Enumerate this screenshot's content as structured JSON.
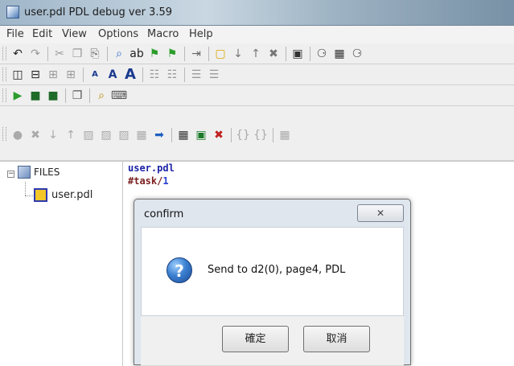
{
  "window": {
    "title": "user.pdl  PDL debug ver 3.59"
  },
  "menu": [
    "File",
    "Edit",
    "View",
    "Options",
    "Macro",
    "Help"
  ],
  "toolbar1": [
    {
      "icon": "undo-icon",
      "glyph": "↶",
      "color": "#222"
    },
    {
      "icon": "redo-icon",
      "glyph": "↷",
      "color": "#999"
    },
    {
      "sep": true
    },
    {
      "icon": "cut-icon",
      "glyph": "✂",
      "color": "#999"
    },
    {
      "icon": "copy-icon",
      "glyph": "❐",
      "color": "#999"
    },
    {
      "icon": "paste-icon",
      "glyph": "⎘",
      "color": "#666"
    },
    {
      "sep": true
    },
    {
      "icon": "find-icon",
      "glyph": "⌕",
      "color": "#2a6cc7"
    },
    {
      "icon": "replace-icon",
      "glyph": "ab",
      "color": "#222"
    },
    {
      "icon": "find-next-icon",
      "glyph": "⚑",
      "color": "#2a9d2a"
    },
    {
      "icon": "find-prev-icon",
      "glyph": "⚑",
      "color": "#2a9d2a"
    },
    {
      "sep": true
    },
    {
      "icon": "indent-icon",
      "glyph": "⇥",
      "color": "#666"
    },
    {
      "sep": true
    },
    {
      "icon": "bookmark-icon",
      "glyph": "▢",
      "color": "#d8a800"
    },
    {
      "icon": "next-bookmark-icon",
      "glyph": "↓",
      "color": "#777"
    },
    {
      "icon": "prev-bookmark-icon",
      "glyph": "↑",
      "color": "#777"
    },
    {
      "icon": "clear-bookmarks-icon",
      "glyph": "✖",
      "color": "#777"
    },
    {
      "sep": true
    },
    {
      "icon": "save-all-icon",
      "glyph": "▣",
      "color": "#333"
    },
    {
      "sep": true
    },
    {
      "icon": "binoculars-icon",
      "glyph": "⚆",
      "color": "#333"
    },
    {
      "icon": "find-in-files-icon",
      "glyph": "▦",
      "color": "#333"
    },
    {
      "icon": "search-binoculars-icon",
      "glyph": "⚆",
      "color": "#333"
    }
  ],
  "toolbar2": [
    {
      "icon": "split-vertical-icon",
      "glyph": "◫",
      "color": "#222"
    },
    {
      "icon": "split-horizontal-icon",
      "glyph": "⊟",
      "color": "#222"
    },
    {
      "icon": "tile-icon",
      "glyph": "⊞",
      "color": "#999"
    },
    {
      "icon": "tile-grid-icon",
      "glyph": "⊞",
      "color": "#999"
    },
    {
      "sep": true
    },
    {
      "icon": "font-small-icon",
      "glyph": "A",
      "color": "#1b3a8f",
      "size": "10px"
    },
    {
      "icon": "font-medium-icon",
      "glyph": "A",
      "color": "#1b3a8f",
      "size": "14px"
    },
    {
      "icon": "font-large-icon",
      "glyph": "A",
      "color": "#1b3a8f",
      "size": "18px"
    },
    {
      "sep": true
    },
    {
      "icon": "format-icon",
      "glyph": "☷",
      "color": "#999"
    },
    {
      "icon": "format-block-icon",
      "glyph": "☷",
      "color": "#999"
    },
    {
      "sep": true
    },
    {
      "icon": "align-icon",
      "glyph": "☰",
      "color": "#999"
    },
    {
      "icon": "align-outdent-icon",
      "glyph": "☰",
      "color": "#999"
    }
  ],
  "toolbar3": [
    {
      "icon": "open-folder-icon",
      "glyph": "▶",
      "color": "#2d9b2d"
    },
    {
      "icon": "save-icon",
      "glyph": "■",
      "color": "#1f6b2a"
    },
    {
      "icon": "save-as-icon",
      "glyph": "■",
      "color": "#1f6b2a"
    },
    {
      "sep": true
    },
    {
      "icon": "pages-icon",
      "glyph": "❐",
      "color": "#555"
    },
    {
      "sep": true
    },
    {
      "icon": "zoom-icon",
      "glyph": "⌕",
      "color": "#b38600"
    },
    {
      "icon": "keyboard-icon",
      "glyph": "⌨",
      "color": "#555"
    }
  ],
  "toolbar4": [
    {
      "icon": "breakpoint-icon",
      "glyph": "●",
      "color": "#aaa"
    },
    {
      "icon": "clear-breakpoint-icon",
      "glyph": "✖",
      "color": "#aaa"
    },
    {
      "icon": "step-into-icon",
      "glyph": "↓",
      "color": "#aaa"
    },
    {
      "icon": "step-out-icon",
      "glyph": "↑",
      "color": "#aaa"
    },
    {
      "icon": "run-icon",
      "glyph": "▨",
      "color": "#aaa"
    },
    {
      "icon": "run-to-cursor-icon",
      "glyph": "▨",
      "color": "#aaa"
    },
    {
      "icon": "compile-icon",
      "glyph": "▨",
      "color": "#aaa"
    },
    {
      "icon": "watch-icon",
      "glyph": "▦",
      "color": "#aaa"
    },
    {
      "icon": "go-icon",
      "glyph": "➡",
      "color": "#1e60c0"
    },
    {
      "sep": true
    },
    {
      "icon": "download-icon",
      "glyph": "▦",
      "color": "#333"
    },
    {
      "icon": "send-icon",
      "glyph": "▣",
      "color": "#1a7a2a"
    },
    {
      "icon": "cancel-send-icon",
      "glyph": "✖",
      "color": "#c02020"
    },
    {
      "sep": true
    },
    {
      "icon": "brace-icon",
      "glyph": "{}",
      "color": "#aaa"
    },
    {
      "icon": "brace-match-icon",
      "glyph": "{}",
      "color": "#aaa"
    },
    {
      "sep": true
    },
    {
      "icon": "settings-icon",
      "glyph": "▦",
      "color": "#aaa"
    }
  ],
  "tree": {
    "root_label": "FILES",
    "root_expander": "−",
    "file_label": "user.pdl"
  },
  "editor": {
    "lines": [
      {
        "text": "user.pdl",
        "color": "#1c23a6"
      },
      {
        "text": "#task/",
        "color": "#7b1f1f",
        "suffix": "1",
        "suffix_color": "#2a3fd0"
      }
    ]
  },
  "dialog": {
    "title": "confirm",
    "close_glyph": "✕",
    "message": "Send to d2(0),  page4,  PDL",
    "question_glyph": "?",
    "ok_label": "確定",
    "cancel_label": "取消"
  }
}
